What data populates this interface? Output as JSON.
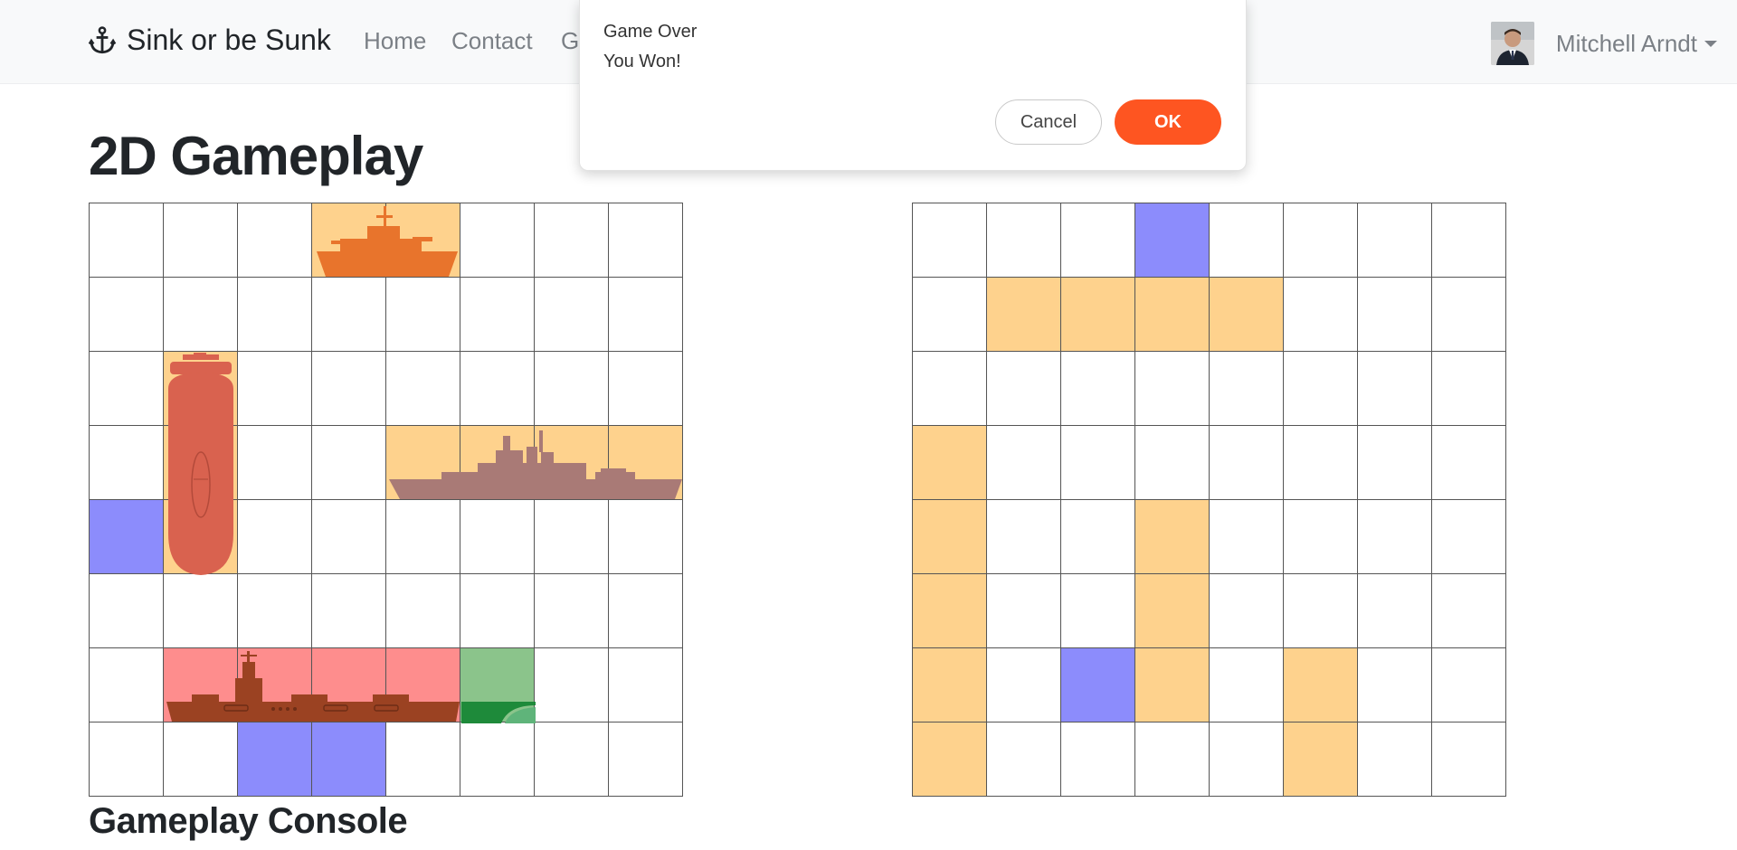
{
  "navbar": {
    "brand_icon": "anchor-icon",
    "brand": "Sink or be Sunk",
    "links": [
      "Home",
      "Contact",
      "G"
    ],
    "user_name": "Mitchell Arndt",
    "avatar_icon": "user-avatar"
  },
  "main": {
    "title": "2D Gameplay",
    "console_title": "Gameplay Console"
  },
  "dialog": {
    "title": "Game Over",
    "message": "You Won!",
    "cancel_label": "Cancel",
    "ok_label": "OK"
  },
  "colors": {
    "ship": "#fed28d",
    "miss": "#8c8cfc",
    "sunk": "#fe8d8d",
    "selected": "#8bc48b",
    "ok_button": "#fe5521"
  },
  "player_board": [
    [
      "empty",
      "empty",
      "empty",
      "ship",
      "ship",
      "empty",
      "empty",
      "empty"
    ],
    [
      "empty",
      "empty",
      "empty",
      "empty",
      "empty",
      "empty",
      "empty",
      "empty"
    ],
    [
      "empty",
      "ship",
      "empty",
      "empty",
      "empty",
      "empty",
      "empty",
      "empty"
    ],
    [
      "empty",
      "ship",
      "empty",
      "empty",
      "ship",
      "ship",
      "ship",
      "ship"
    ],
    [
      "miss",
      "ship",
      "empty",
      "empty",
      "empty",
      "empty",
      "empty",
      "empty"
    ],
    [
      "empty",
      "empty",
      "empty",
      "empty",
      "empty",
      "empty",
      "empty",
      "empty"
    ],
    [
      "empty",
      "sunk",
      "sunk",
      "sunk",
      "sunk",
      "sel",
      "empty",
      "empty"
    ],
    [
      "empty",
      "empty",
      "miss",
      "miss",
      "empty",
      "empty",
      "empty",
      "empty"
    ]
  ],
  "enemy_board": [
    [
      "empty",
      "empty",
      "empty",
      "miss",
      "empty",
      "empty",
      "empty",
      "empty"
    ],
    [
      "empty",
      "ship",
      "ship",
      "ship",
      "ship",
      "empty",
      "empty",
      "empty"
    ],
    [
      "empty",
      "empty",
      "empty",
      "empty",
      "empty",
      "empty",
      "empty",
      "empty"
    ],
    [
      "ship",
      "empty",
      "empty",
      "empty",
      "empty",
      "empty",
      "empty",
      "empty"
    ],
    [
      "ship",
      "empty",
      "empty",
      "ship",
      "empty",
      "empty",
      "empty",
      "empty"
    ],
    [
      "ship",
      "empty",
      "empty",
      "ship",
      "empty",
      "empty",
      "empty",
      "empty"
    ],
    [
      "ship",
      "empty",
      "miss",
      "ship",
      "empty",
      "ship",
      "empty",
      "empty"
    ],
    [
      "ship",
      "empty",
      "empty",
      "empty",
      "empty",
      "ship",
      "empty",
      "empty"
    ]
  ]
}
